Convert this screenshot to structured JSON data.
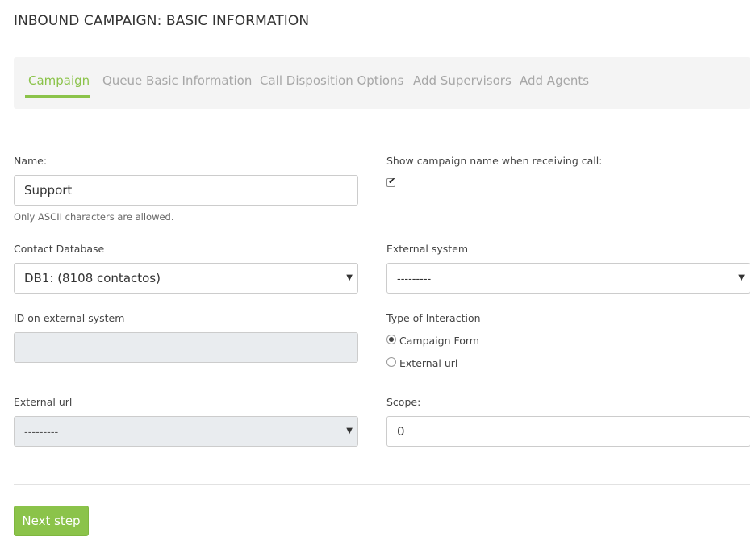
{
  "page": {
    "title": "INBOUND CAMPAIGN: BASIC INFORMATION"
  },
  "tabs": [
    {
      "label": "Campaign",
      "active": true
    },
    {
      "label": "Queue Basic Information",
      "active": false
    },
    {
      "label": "Call Disposition Options",
      "active": false
    },
    {
      "label": "Add Supervisors",
      "active": false
    },
    {
      "label": "Add Agents",
      "active": false
    }
  ],
  "form": {
    "name": {
      "label": "Name:",
      "value": "Support",
      "help": "Only ASCII characters are allowed."
    },
    "show_campaign_name": {
      "label": "Show campaign name when receiving call:",
      "checked": true
    },
    "contact_database": {
      "label": "Contact Database",
      "selected": "DB1: (8108 contactos)"
    },
    "external_system": {
      "label": "External system",
      "selected": "---------"
    },
    "id_external_system": {
      "label": "ID on external system",
      "value": "",
      "disabled": true
    },
    "type_of_interaction": {
      "label": "Type of Interaction",
      "options": [
        {
          "label": "Campaign Form",
          "checked": true
        },
        {
          "label": "External url",
          "checked": false
        }
      ]
    },
    "external_url": {
      "label": "External url",
      "selected": "---------",
      "disabled": true
    },
    "scope": {
      "label": "Scope:",
      "value": "0"
    }
  },
  "actions": {
    "next_label": "Next step"
  },
  "colors": {
    "accent": "#8bc34a",
    "tab_inactive": "#a7a7a7",
    "disabled_bg": "#e9ecef"
  },
  "icons": {
    "select_caret": "caret-down-icon",
    "checkbox_check": "check-icon"
  }
}
